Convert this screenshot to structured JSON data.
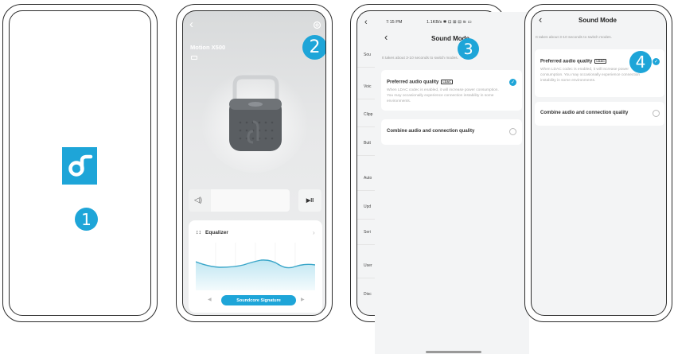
{
  "steps": [
    "1",
    "2",
    "3",
    "4"
  ],
  "device": {
    "name": "Motion X500",
    "equalizer_label": "Equalizer",
    "eq_preset": "Soundcore Signature",
    "play_label": "▶II"
  },
  "settings_list": {
    "items": [
      "Sou",
      "Voic",
      "Clipp",
      "Butt",
      "Auto",
      "Upd",
      "Seri",
      "User",
      "Disc"
    ]
  },
  "status_bar": {
    "time": "7:15 PM",
    "icons": "1.1KB/s ✱ ⊡ ⊞ ⊟ ≋ ▭"
  },
  "sound_mode": {
    "title": "Sound Mode",
    "hint": "It takes about 3-10 seconds to switch modes.",
    "options": [
      {
        "title": "Preferred audio quality",
        "badge": "LDAC",
        "description": "When LDAC codec is enabled, it will increase power consumption. You may occasionally experience connection instability in some environments.",
        "selected": true
      },
      {
        "title": "Combine audio and connection quality",
        "selected": false
      }
    ]
  },
  "colors": {
    "accent": "#1ea5d8",
    "eq_curve": "#3aa6c9"
  }
}
